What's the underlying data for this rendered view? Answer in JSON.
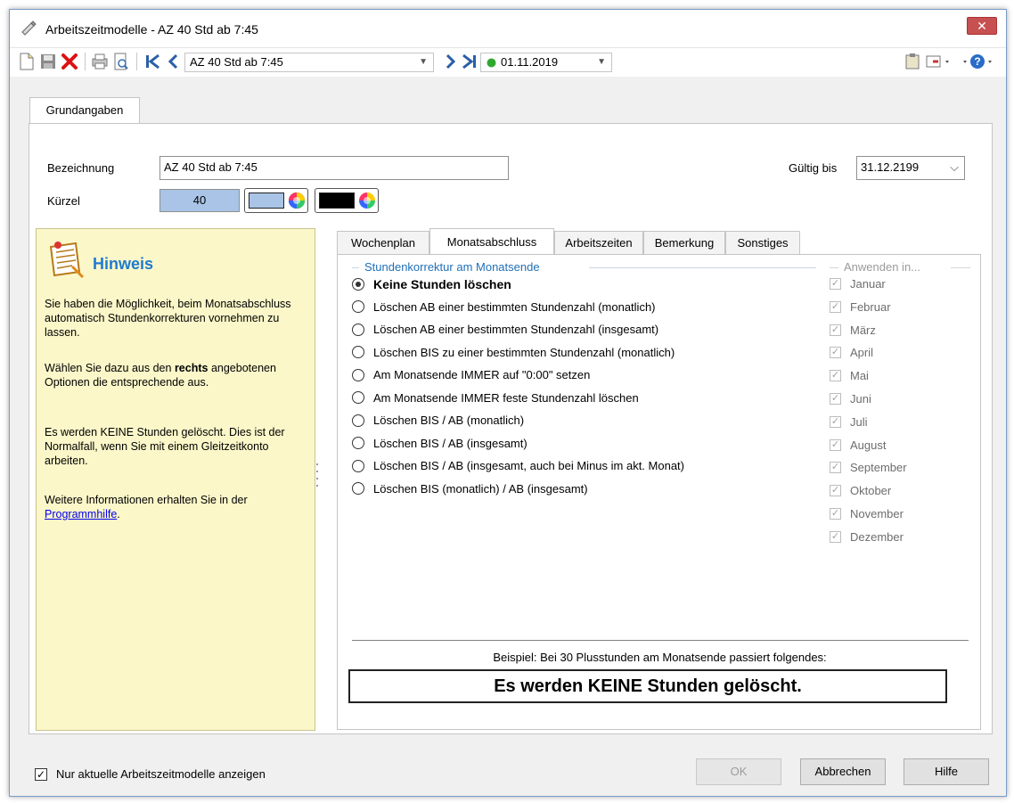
{
  "window": {
    "title": "Arbeitszeitmodelle - AZ 40 Std ab 7:45",
    "close_label": "✕"
  },
  "toolbar": {
    "model_combo_value": "AZ 40 Std ab 7:45",
    "date_combo_value": "01.11.2019",
    "status_color": "#2fa82f"
  },
  "tabs": {
    "main": "Grundangaben"
  },
  "form": {
    "bezeichnung_label": "Bezeichnung",
    "bezeichnung_value": "AZ 40 Std ab 7:45",
    "kuerzel_label": "Kürzel",
    "kuerzel_value": "40",
    "gueltig_label": "Gültig bis",
    "gueltig_value": "31.12.2199",
    "kuerzel_bg_color": "#a9c4e6",
    "font_color": "#000000"
  },
  "hint": {
    "title": "Hinweis",
    "p1": "Sie haben die Möglichkeit, beim Monatsabschluss automatisch Stundenkorrekturen vornehmen zu lassen.",
    "p2_a": "Wählen Sie dazu aus den ",
    "p2_bold": "rechts",
    "p2_b": " angebotenen Optionen die entsprechende aus.",
    "p3": "Es werden KEINE Stunden gelöscht. Dies ist der Normalfall, wenn Sie mit einem Gleitzeitkonto arbeiten.",
    "p4": "Weitere Informationen erhalten Sie in der",
    "link": "Programmhilfe",
    "link_suffix": "."
  },
  "inner_tabs": [
    "Wochenplan",
    "Monatsabschluss",
    "Arbeitszeiten",
    "Bemerkung",
    "Sonstiges"
  ],
  "correction": {
    "group_title": "Stundenkorrektur am Monatsende",
    "options": [
      "Keine Stunden löschen",
      "Löschen AB einer bestimmten Stundenzahl (monatlich)",
      "Löschen AB einer bestimmten Stundenzahl (insgesamt)",
      "Löschen BIS zu einer bestimmten Stundenzahl (monatlich)",
      "Am Monatsende IMMER auf \"0:00\" setzen",
      "Am Monatsende IMMER feste Stundenzahl löschen",
      "Löschen BIS / AB (monatlich)",
      "Löschen BIS / AB (insgesamt)",
      "Löschen BIS / AB (insgesamt, auch bei Minus im akt. Monat)",
      "Löschen BIS (monatlich) / AB (insgesamt)"
    ],
    "selected_index": 0
  },
  "apply": {
    "group_title": "Anwenden in...",
    "months": [
      "Januar",
      "Februar",
      "März",
      "April",
      "Mai",
      "Juni",
      "Juli",
      "August",
      "September",
      "Oktober",
      "November",
      "Dezember"
    ]
  },
  "example": {
    "caption": "Beispiel: Bei 30 Plusstunden am Monatsende passiert folgendes:",
    "result": "Es werden KEINE Stunden gelöscht."
  },
  "footer": {
    "checkbox_label": "Nur aktuelle Arbeitszeitmodelle anzeigen",
    "ok": "OK",
    "cancel": "Abbrechen",
    "help": "Hilfe"
  }
}
